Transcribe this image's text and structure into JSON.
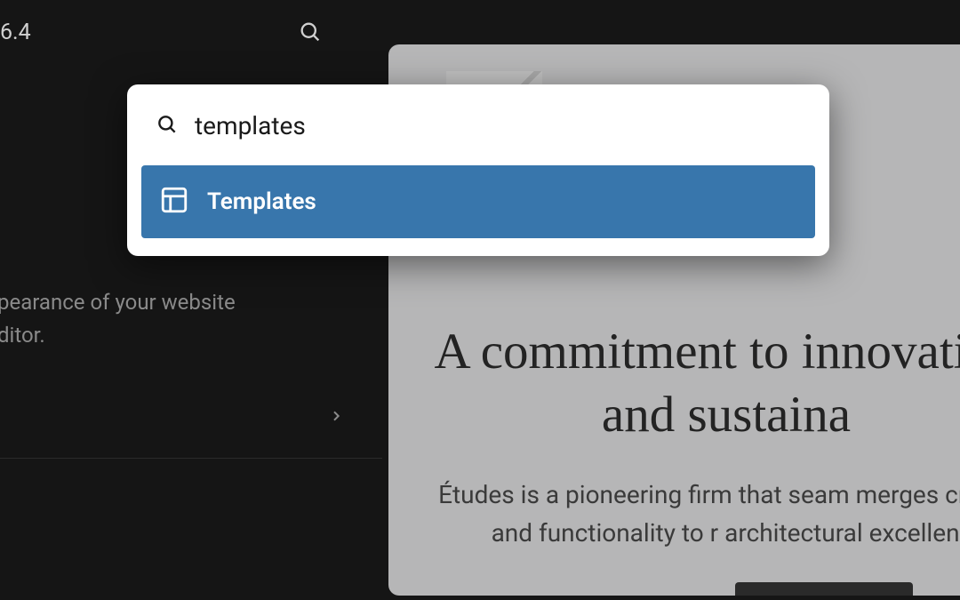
{
  "header": {
    "version": "6.4"
  },
  "sidebar": {
    "description_line1": "pearance of your website",
    "description_line2": "ditor."
  },
  "preview": {
    "heading": "A commitment to innovation and sustaina",
    "body": "Études is a pioneering firm that seam merges creativity and functionality to r architectural excellence."
  },
  "command_palette": {
    "search_value": "templates",
    "results": [
      {
        "label": "Templates"
      }
    ]
  }
}
